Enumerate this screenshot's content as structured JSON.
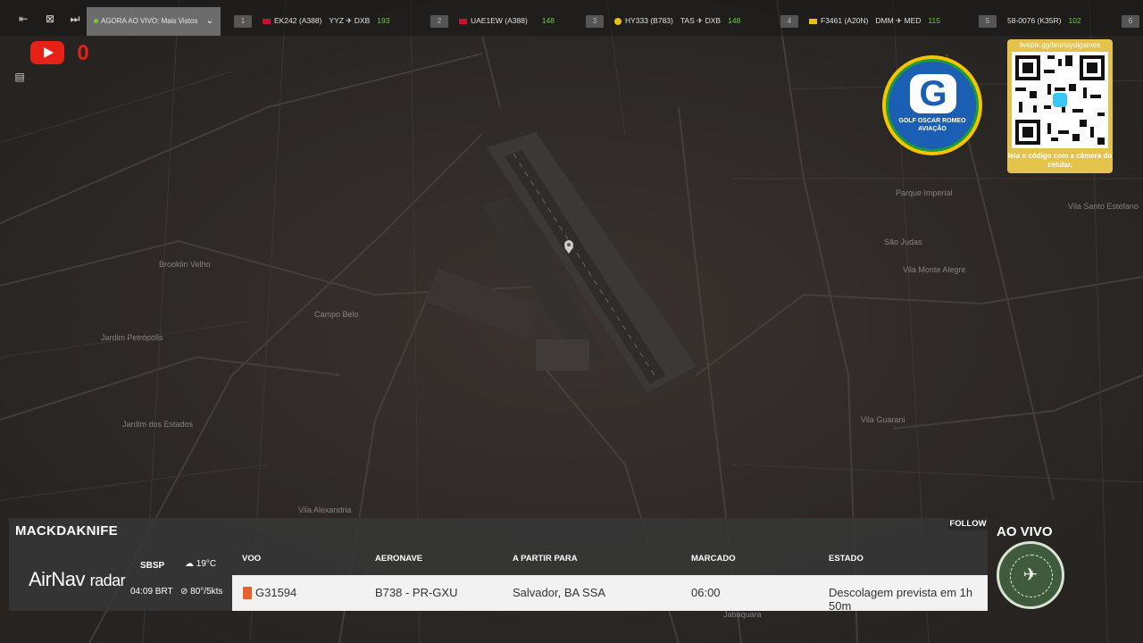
{
  "topbar": {
    "now_live_label": "AGORA AO VIVO: Mais Vistos",
    "icons": [
      "collapse-icon",
      "close-panel-icon",
      "skip-icon",
      "chevron-down-icon"
    ],
    "flights": [
      {
        "num": "1",
        "callsign": "EK242 (A388)",
        "route": "YYZ ✈ DXB",
        "count": "193"
      },
      {
        "num": "2",
        "callsign": "UAE1EW (A388)",
        "route": "",
        "count": "148"
      },
      {
        "num": "3",
        "callsign": "HY333 (B783)",
        "route": "TAS ✈ DXB",
        "count": "148"
      },
      {
        "num": "4",
        "callsign": "F3461 (A20N)",
        "route": "DMM ✈ MED",
        "count": "115"
      },
      {
        "num": "5",
        "callsign": "58-0076 (K35R)",
        "route": "",
        "count": "102"
      },
      {
        "num": "6",
        "callsign": "",
        "route": "",
        "count": ""
      }
    ]
  },
  "youtube": {
    "count": "0"
  },
  "logos": {
    "gor_line1": "GOLF OSCAR ROMEO",
    "gor_line2": "AVIAÇÃO",
    "qr_url": "livepix.gg/brunoydigames",
    "qr_caption": "leia o código com a câmera do celular."
  },
  "map_labels": [
    "Brooklin Velho",
    "Campo Belo",
    "Jardim Petrópolis",
    "Jardim dos Estados",
    "Vila Alexandria",
    "Parque Imperial",
    "São Judas",
    "Vila Monte Alegre",
    "Vila Guarani",
    "Vila Santo Estéfano",
    "Jabaquara"
  ],
  "panel": {
    "username": "MACKDAKNIFE",
    "follow": "FOLLOW",
    "brand_main": "AirNav",
    "brand_sub": "radar",
    "airport": "SBSP",
    "time": "04:09 BRT",
    "temp": "19°C",
    "wind": "80°/5kts",
    "headers": {
      "flight": "VOO",
      "aircraft": "AERONAVE",
      "from_to": "A PARTIR PARA",
      "scheduled": "MARCADO",
      "status": "ESTADO"
    },
    "row": {
      "flight": "G31594",
      "aircraft": "B738 - PR-GXU",
      "from_to": "Salvador, BA SSA",
      "scheduled": "06:00",
      "status": "Descolagem prevista em 1h 50m"
    }
  },
  "ao_vivo": "AO VIVO",
  "colors": {
    "accent_green": "#6bcc3a",
    "youtube_red": "#e62117",
    "airline_orange": "#e8632b"
  }
}
